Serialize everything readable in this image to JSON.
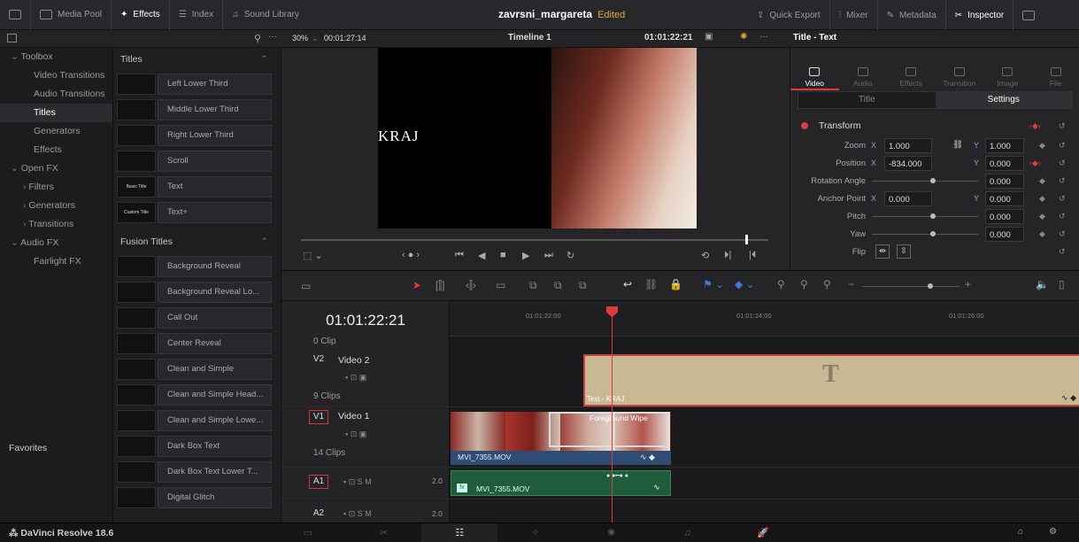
{
  "topbar": {
    "media_pool": "Media Pool",
    "effects": "Effects",
    "index": "Index",
    "sound_library": "Sound Library",
    "project_name": "zavrsni_margareta",
    "project_status": "Edited",
    "quick_export": "Quick Export",
    "mixer": "Mixer",
    "metadata": "Metadata",
    "inspector": "Inspector"
  },
  "viewer": {
    "zoom": "30%",
    "timecode_duration": "00:01:27:14",
    "timeline_name": "Timeline 1",
    "timecode_current": "01:01:22:21",
    "overlay_text": "KRAJ"
  },
  "toolbox": {
    "items": [
      {
        "label": "Toolbox",
        "level": "l1"
      },
      {
        "label": "Video Transitions",
        "level": "l2"
      },
      {
        "label": "Audio Transitions",
        "level": "l2"
      },
      {
        "label": "Titles",
        "level": "sel"
      },
      {
        "label": "Generators",
        "level": "l2"
      },
      {
        "label": "Effects",
        "level": "l2"
      },
      {
        "label": "Open FX",
        "level": "l1"
      },
      {
        "label": "Filters",
        "level": "l2b"
      },
      {
        "label": "Generators",
        "level": "l2b"
      },
      {
        "label": "Transitions",
        "level": "l2b"
      },
      {
        "label": "Audio FX",
        "level": "l1"
      },
      {
        "label": "Fairlight FX",
        "level": "l2"
      }
    ],
    "favorites": "Favorites"
  },
  "titles_panel": {
    "header": "Titles",
    "items": [
      {
        "label": "Left Lower Third",
        "thumb": ""
      },
      {
        "label": "Middle Lower Third",
        "thumb": ""
      },
      {
        "label": "Right Lower Third",
        "thumb": ""
      },
      {
        "label": "Scroll",
        "thumb": ""
      },
      {
        "label": "Text",
        "thumb": "Basic Title"
      },
      {
        "label": "Text+",
        "thumb": "Custom Title"
      }
    ],
    "fusion_header": "Fusion Titles",
    "fusion_items": [
      {
        "label": "Background Reveal"
      },
      {
        "label": "Background Reveal Lo..."
      },
      {
        "label": "Call Out"
      },
      {
        "label": "Center Reveal"
      },
      {
        "label": "Clean and Simple"
      },
      {
        "label": "Clean and Simple Head..."
      },
      {
        "label": "Clean and Simple Lowe..."
      },
      {
        "label": "Dark Box Text"
      },
      {
        "label": "Dark Box Text Lower T..."
      },
      {
        "label": "Digital Glitch"
      }
    ]
  },
  "inspector": {
    "title": "Title - Text",
    "tabs": [
      "Video",
      "Audio",
      "Effects",
      "Transition",
      "Image",
      "File"
    ],
    "subtabs": [
      "Title",
      "Settings"
    ],
    "section": "Transform",
    "props": {
      "zoom_label": "Zoom",
      "zoom_x": "1.000",
      "zoom_y": "1.000",
      "position_label": "Position",
      "position_x": "-834.000",
      "position_y": "0.000",
      "rotation_label": "Rotation Angle",
      "rotation_val": "0.000",
      "anchor_label": "Anchor Point",
      "anchor_x": "0.000",
      "anchor_y": "0.000",
      "pitch_label": "Pitch",
      "pitch_val": "0.000",
      "yaw_label": "Yaw",
      "yaw_val": "0.000",
      "flip_label": "Flip",
      "x_axis": "X",
      "y_axis": "Y"
    }
  },
  "timeline": {
    "timecode": "01:01:22:21",
    "ruler_ticks": [
      "01:01:22:00",
      "01:01:24:00",
      "01:01:26:00"
    ],
    "clip_partial": "0 Clip",
    "v2_tag": "V2",
    "v2_name": "Video 2",
    "v2_clips": "9 Clips",
    "v1_tag": "V1",
    "v1_name": "Video 1",
    "v1_clips": "14 Clips",
    "a1_tag": "A1",
    "a1_level": "2.0",
    "a2_tag": "A2",
    "a2_level": "2.0",
    "title_clip_name": "Text - KRAJ",
    "title_glyph": "T",
    "video_clip_name": "MVI_7355.MOV",
    "transition_name": "Foreground Wipe",
    "audio_clip_name": "MVI_7355.MOV"
  },
  "bottombar": {
    "brand": "DaVinci Resolve 18.6"
  }
}
